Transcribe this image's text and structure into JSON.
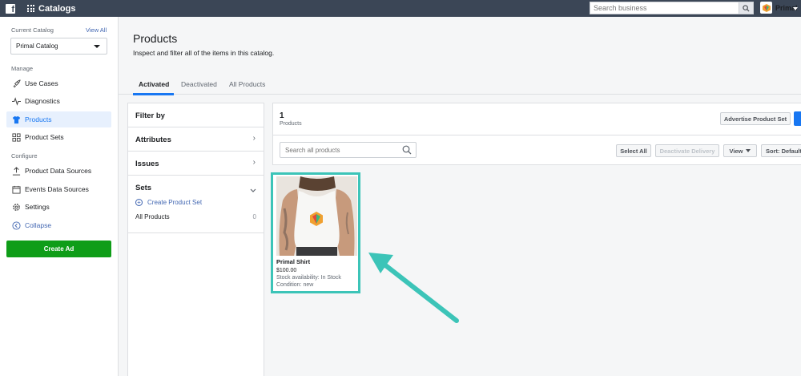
{
  "topbar": {
    "app_title": "Catalogs",
    "search_placeholder": "Search business",
    "user_name": "Primal"
  },
  "sidebar": {
    "current_catalog_label": "Current Catalog",
    "view_all": "View All",
    "catalog_selected": "Primal Catalog",
    "manage_label": "Manage",
    "manage_items": [
      {
        "label": "Use Cases",
        "icon": "rocket-icon"
      },
      {
        "label": "Diagnostics",
        "icon": "pulse-icon"
      },
      {
        "label": "Products",
        "icon": "shirt-icon",
        "active": true
      },
      {
        "label": "Product Sets",
        "icon": "grid-icon"
      }
    ],
    "configure_label": "Configure",
    "configure_items": [
      {
        "label": "Product Data Sources",
        "icon": "upload-icon"
      },
      {
        "label": "Events Data Sources",
        "icon": "calendar-icon"
      },
      {
        "label": "Settings",
        "icon": "gear-icon"
      }
    ],
    "collapse": "Collapse",
    "create_ad": "Create Ad"
  },
  "main": {
    "title": "Products",
    "subtitle": "Inspect and filter all of the items in this catalog.",
    "tabs": [
      "Activated",
      "Deactivated",
      "All Products"
    ]
  },
  "filter": {
    "title": "Filter by",
    "attributes": "Attributes",
    "issues": "Issues",
    "sets": "Sets",
    "create_product_set": "Create Product Set",
    "all_products": "All Products",
    "all_products_count": "0"
  },
  "results": {
    "count": "1",
    "count_label": "Products",
    "advertise_button": "Advertise Product Set",
    "search_placeholder": "Search all products",
    "select_all": "Select All",
    "deactivate_delivery": "Deactivate Delivery",
    "view": "View",
    "sort": "Sort: Default"
  },
  "product": {
    "name": "Primal Shirt",
    "price": "$100.00",
    "stock": "Stock availability: In Stock",
    "condition": "Condition: new"
  },
  "colors": {
    "accent": "#1877f2",
    "highlight": "#3cc4b8",
    "create_ad": "#0f9d18",
    "topbar": "#3b4656"
  }
}
